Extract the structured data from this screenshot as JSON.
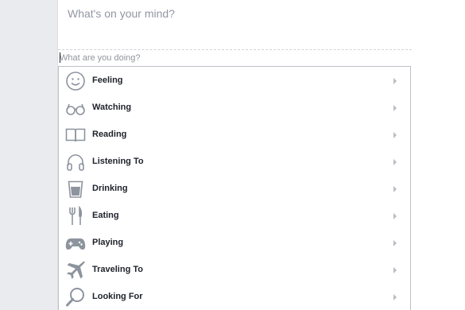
{
  "composer": {
    "placeholder": "What's on your mind?"
  },
  "activity": {
    "placeholder": "What are you doing?"
  },
  "menu": {
    "items": [
      {
        "label": "Feeling",
        "icon": "smiley-icon"
      },
      {
        "label": "Watching",
        "icon": "glasses-icon"
      },
      {
        "label": "Reading",
        "icon": "book-icon"
      },
      {
        "label": "Listening To",
        "icon": "headphones-icon"
      },
      {
        "label": "Drinking",
        "icon": "cup-icon"
      },
      {
        "label": "Eating",
        "icon": "fork-knife-icon"
      },
      {
        "label": "Playing",
        "icon": "gamepad-icon"
      },
      {
        "label": "Traveling To",
        "icon": "airplane-icon"
      },
      {
        "label": "Looking For",
        "icon": "magnifier-icon"
      }
    ]
  },
  "colors": {
    "icon_gray": "#8d949e",
    "text": "#1d2129",
    "placeholder": "#90949c",
    "border": "#bdc1c9",
    "chevron": "#b9bdc5"
  }
}
